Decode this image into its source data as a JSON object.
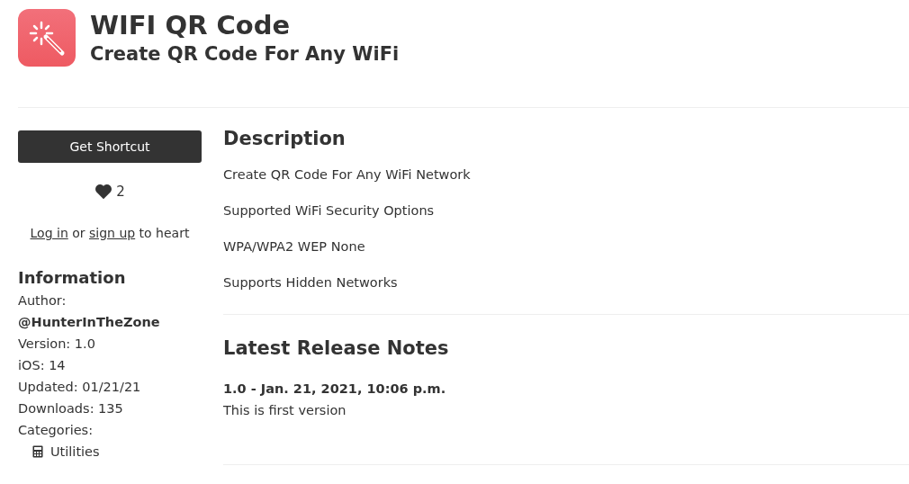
{
  "header": {
    "title": "WIFI QR Code",
    "subtitle": "Create QR Code For Any WiFi"
  },
  "sidebar": {
    "get_button": "Get Shortcut",
    "hearts": "2",
    "login": {
      "link1": "Log in",
      "middle": "or",
      "link2": "sign up",
      "end": "to heart"
    },
    "info_title": "Information",
    "info_lines": [
      {
        "kind": "plain",
        "text": "Author:"
      },
      {
        "kind": "bold",
        "text": "@HunterInTheZone"
      },
      {
        "kind": "plain",
        "text": "Version: 1.0"
      },
      {
        "kind": "plain",
        "text": "iOS: 14"
      },
      {
        "kind": "plain",
        "text": "Updated: 01/21/21"
      },
      {
        "kind": "plain",
        "text": "Downloads: 135"
      },
      {
        "kind": "plain",
        "text": "Categories:"
      }
    ],
    "categories": [
      "Utilities"
    ]
  },
  "description": {
    "title": "Description",
    "paragraphs": [
      "Create QR Code For Any WiFi Network",
      "Supported WiFi Security Options",
      "WPA/WPA2 WEP None",
      "Supports Hidden Networks"
    ]
  },
  "release_notes": {
    "title": "Latest Release Notes",
    "version": "1.0 - Jan. 21, 2021, 10:06 p.m.",
    "text": "This is first version"
  }
}
